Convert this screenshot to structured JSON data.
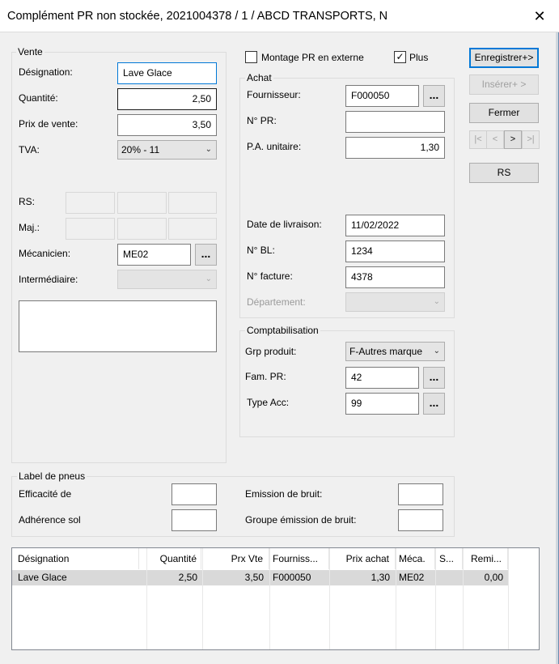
{
  "window": {
    "title": "Complément PR non stockée, 2021004378 / 1 / ABCD TRANSPORTS, N",
    "close_glyph": "✕"
  },
  "vente": {
    "group_label": "Vente",
    "designation_label": "Désignation:",
    "designation_value": "Lave Glace",
    "quantite_label": "Quantité:",
    "quantite_value": "2,50",
    "prix_label": "Prix de vente:",
    "prix_value": "3,50",
    "tva_label": "TVA:",
    "tva_value": "20% - 11",
    "rs_label": "RS:",
    "maj_label": "Maj.:",
    "mecanicien_label": "Mécanicien:",
    "mecanicien_value": "ME02",
    "intermediaire_label": "Intermédiaire:",
    "intermediaire_value": "",
    "notes_value": ""
  },
  "options": {
    "montage_label": "Montage PR en externe",
    "montage_checked": false,
    "plus_label": "Plus",
    "plus_checked": true
  },
  "achat": {
    "group_label": "Achat",
    "fournisseur_label": "Fournisseur:",
    "fournisseur_value": "F000050",
    "npr_label": "N° PR:",
    "npr_value": "",
    "pa_label": "P.A. unitaire:",
    "pa_value": "1,30",
    "date_label": "Date de livraison:",
    "date_value": "11/02/2022",
    "nbl_label": "N° BL:",
    "nbl_value": "1234",
    "nfacture_label": "N° facture:",
    "nfacture_value": "4378",
    "departement_label": "Département:",
    "departement_value": ""
  },
  "compta": {
    "group_label": "Comptabilisation",
    "grp_label": "Grp produit:",
    "grp_value": "F-Autres marque",
    "fam_label": "Fam. PR:",
    "fam_value": "42",
    "type_label": "Type Acc:",
    "type_value": "99"
  },
  "pneus": {
    "group_label": "Label de pneus",
    "efficacite_label": "Efficacité de",
    "adherence_label": "Adhérence sol",
    "emission_label": "Emission de bruit:",
    "groupe_label": "Groupe émission de bruit:"
  },
  "buttons": {
    "enregistrer": "Enregistrer+>",
    "inserer": "Insérer+ >",
    "fermer": "Fermer",
    "first": "|<",
    "prev": "<",
    "next": ">",
    "last": ">|",
    "rs": "RS",
    "dots": "..."
  },
  "grid": {
    "columns": [
      "Désignation",
      "Quantité",
      "Prx Vte",
      "Fourniss...",
      "Prix achat",
      "Méca.",
      "S...",
      "Remi..."
    ],
    "rows": [
      [
        "Lave Glace",
        "2,50",
        "3,50",
        "F000050",
        "1,30",
        "ME02",
        "",
        "0,00"
      ]
    ]
  },
  "colors": {
    "focus_border": "#0078d7",
    "window_bg": "#f0f0f0",
    "selected_row": "#d9d9d9"
  }
}
